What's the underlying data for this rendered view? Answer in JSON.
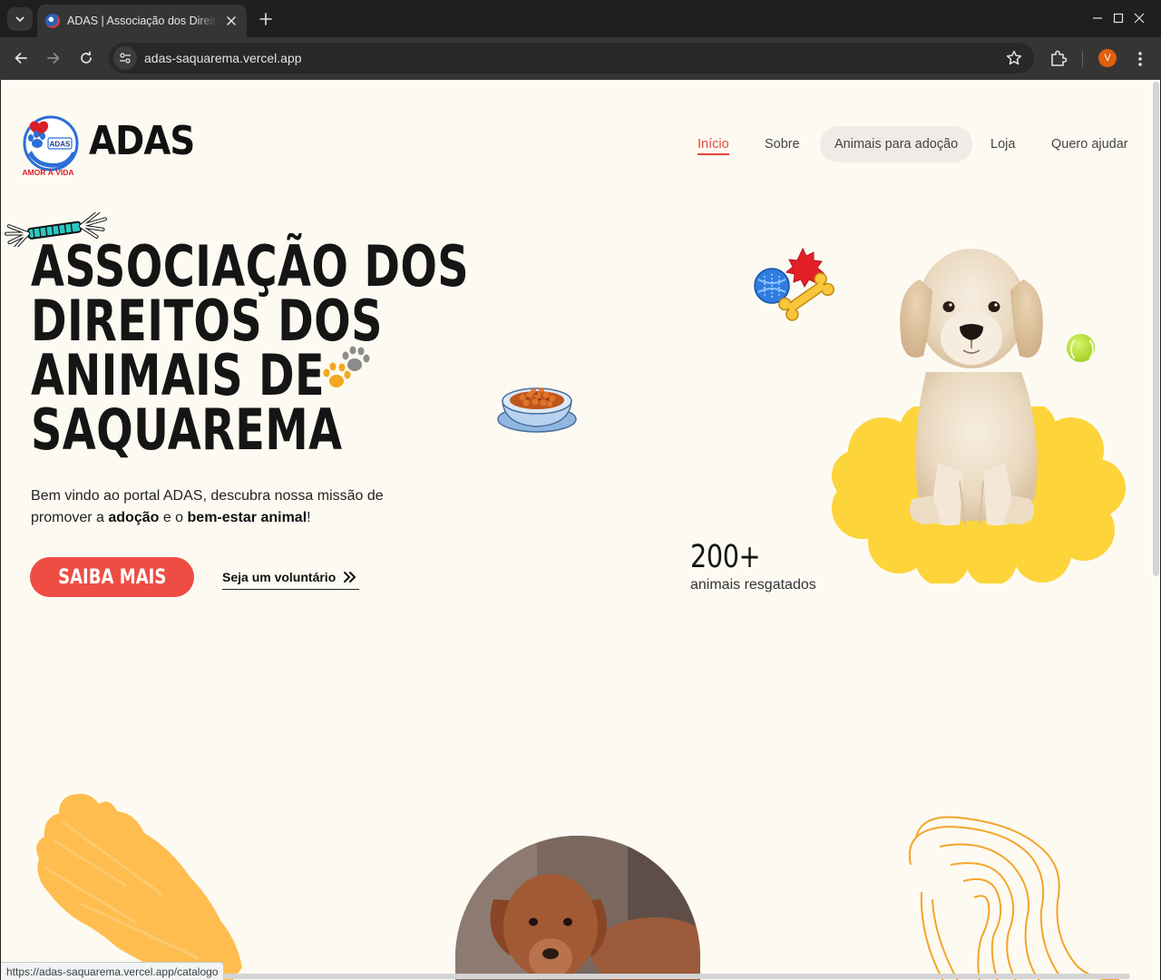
{
  "browser": {
    "tab_title": "ADAS | Associação dos Direitos dos Animais de Saquarema",
    "url": "adas-saquarema.vercel.app",
    "profile_initial": "V",
    "status_url": "https://adas-saquarema.vercel.app/catalogo"
  },
  "header": {
    "brand": "ADAS",
    "logo": {
      "badge_text": "ADAS",
      "slogan": "AMOR À VIDA"
    },
    "nav": [
      {
        "label": "Início",
        "active": true
      },
      {
        "label": "Sobre",
        "active": false
      },
      {
        "label": "Animais para adoção",
        "active": false,
        "hovered": true
      },
      {
        "label": "Loja",
        "active": false
      },
      {
        "label": "Quero ajudar",
        "active": false
      }
    ]
  },
  "hero": {
    "title_lines": [
      "ASSOCIAÇÃO DOS",
      "DIREITOS DOS",
      "ANIMAIS DE",
      "SAQUAREMA"
    ],
    "intro_prefix": "Bem vindo ao portal ADAS, descubra nossa missão de promover a ",
    "intro_bold_1": "adoção",
    "intro_mid": " e o ",
    "intro_bold_2": "bem-estar animal",
    "intro_suffix": "!",
    "primary_button": "SAIBA MAIS",
    "secondary_link": "Seja um voluntário"
  },
  "stats": {
    "value": "200+",
    "label": "animais resgatados"
  },
  "colors": {
    "accent": "#ef4d43",
    "background": "#fdfaf2",
    "blob": "#fdd43a",
    "brush": "#ffbd4f",
    "contour": "#f4a429"
  }
}
